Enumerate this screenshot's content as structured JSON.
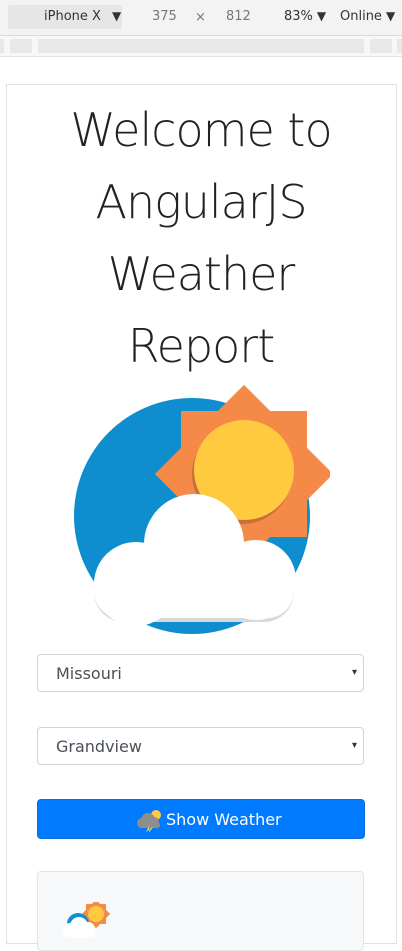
{
  "devtools": {
    "device": "iPhone X",
    "width": "375",
    "times": "×",
    "height": "812",
    "zoom": "83%",
    "network": "Online",
    "caret": "▼"
  },
  "page": {
    "title_lines": [
      "Welcome to",
      "AngularJS",
      "Weather",
      "Report"
    ],
    "state_select": {
      "value": "Missouri"
    },
    "city_select": {
      "value": "Grandview"
    },
    "select_caret": "▾",
    "show_button": {
      "label": "Show Weather"
    }
  },
  "icons": {
    "hero": "sun-cloud-weather-icon",
    "button": "storm-cloud-icon",
    "panel": "partly-sunny-icon"
  },
  "colors": {
    "primary": "#007bff",
    "sun_orange": "#f58a48",
    "sun_yellow": "#ffc940",
    "sky_blue": "#0e8ecf"
  }
}
